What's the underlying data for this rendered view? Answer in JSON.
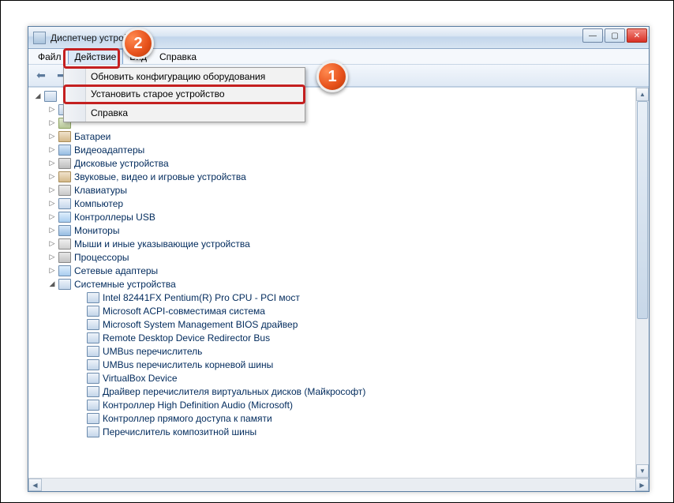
{
  "window": {
    "title": "Диспетчер устройств"
  },
  "menubar": {
    "items": [
      "Файл",
      "Действие",
      "Вид",
      "Справка"
    ],
    "activeIndex": 1
  },
  "dropdown": {
    "items": [
      "Обновить конфигурацию оборудования",
      "Установить старое устройство"
    ],
    "after_sep": "Справка"
  },
  "tree": {
    "root": "",
    "categories": [
      {
        "label": "",
        "icon": "pc",
        "hidden": true
      },
      {
        "label": "",
        "icon": "chip",
        "hidden": true
      },
      {
        "label": "Батареи",
        "icon": "snd"
      },
      {
        "label": "Видеоадаптеры",
        "icon": "mon"
      },
      {
        "label": "Дисковые устройства",
        "icon": "disk"
      },
      {
        "label": "Звуковые, видео и игровые устройства",
        "icon": "snd"
      },
      {
        "label": "Клавиатуры",
        "icon": "kb"
      },
      {
        "label": "Компьютер",
        "icon": "pc"
      },
      {
        "label": "Контроллеры USB",
        "icon": "usb"
      },
      {
        "label": "Мониторы",
        "icon": "mon"
      },
      {
        "label": "Мыши и иные указывающие устройства",
        "icon": "mouse"
      },
      {
        "label": "Процессоры",
        "icon": "cpu"
      },
      {
        "label": "Сетевые адаптеры",
        "icon": "net"
      },
      {
        "label": "Системные устройства",
        "icon": "pc",
        "expanded": true
      }
    ],
    "system_devices": [
      "Intel 82441FX Pentium(R) Pro CPU - PCI мост",
      "Microsoft ACPI-совместимая система",
      "Microsoft System Management BIOS драйвер",
      "Remote Desktop Device Redirector Bus",
      "UMBus перечислитель",
      "UMBus перечислитель корневой шины",
      "VirtualBox Device",
      "Драйвер перечислителя виртуальных дисков (Майкрософт)",
      "Контроллер High Definition Audio (Microsoft)",
      "Контроллер прямого доступа к памяти",
      "Перечислитель композитной шины"
    ]
  },
  "callouts": {
    "one": "1",
    "two": "2"
  }
}
